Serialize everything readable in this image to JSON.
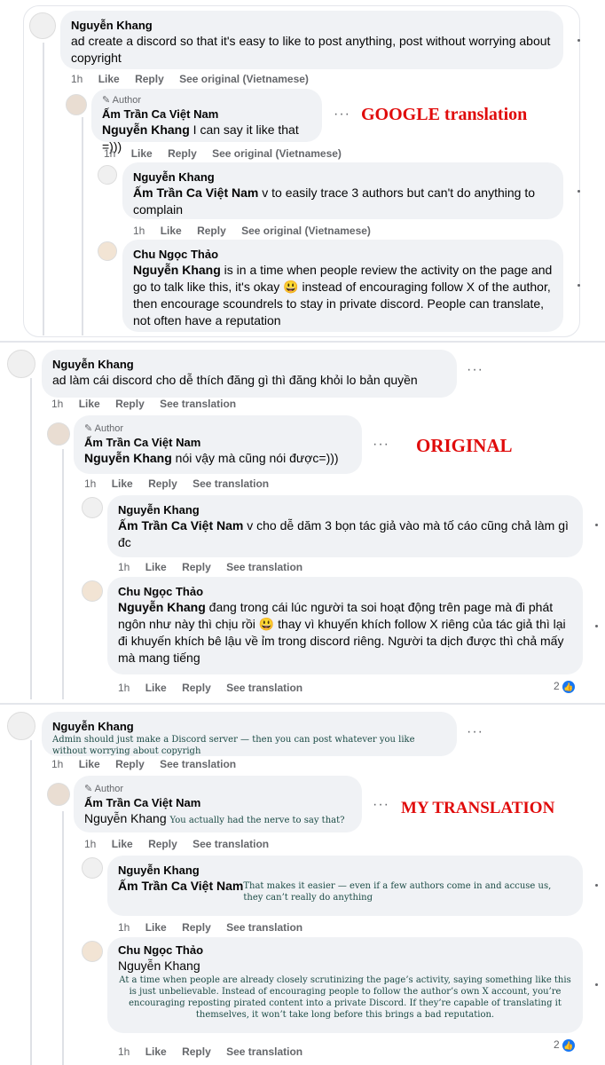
{
  "labels": {
    "google": "GOOGLE translation",
    "original": "ORIGINAL",
    "mine": "MY TRANSLATION"
  },
  "common": {
    "age": "1h",
    "like": "Like",
    "reply": "Reply",
    "see_original": "See original (Vietnamese)",
    "see_translation": "See translation",
    "author": "Author",
    "more": "···",
    "reactions": "2"
  },
  "google": {
    "c1": {
      "name": "Nguyễn Khang",
      "text": "ad create a discord so that it's easy to like to post anything, post without worrying about copyright"
    },
    "c2": {
      "name": "Ấm Trần Ca Việt Nam",
      "mention": "Nguyễn Khang",
      "text": " I can say it like that =)))"
    },
    "c3": {
      "name": "Nguyễn Khang",
      "mention": "Ấm Trần Ca Việt Nam",
      "text": " v to easily trace 3 authors but can't do anything to complain"
    },
    "c4": {
      "name": "Chu Ngọc Thảo",
      "mention": "Nguyễn Khang",
      "text1": " is in a time when people review the activity on the page and go to talk like this, it's okay ",
      "emoji": "😃",
      "text2": " instead of encouraging follow X of the author, then encourage scoundrels to stay in private discord. People can translate, not often have a reputation"
    }
  },
  "original": {
    "c1": {
      "name": "Nguyễn Khang",
      "text": "ad làm cái discord cho dễ thích đăng gì thì đăng khỏi lo bản quyền"
    },
    "c2": {
      "name": "Ấm Trần Ca Việt Nam",
      "mention": "Nguyễn Khang",
      "text": " nói vậy mà cũng nói được=)))"
    },
    "c3": {
      "name": "Nguyễn Khang",
      "mention": "Ấm Trần Ca Việt Nam",
      "text": " v cho dễ dăm 3 bọn tác giả vào mà tố cáo cũng chả làm gì đc"
    },
    "c4": {
      "name": "Chu Ngọc Thảo",
      "mention": "Nguyễn Khang",
      "text1": " đang trong cái lúc người ta soi hoạt động trên page mà đi phát ngôn như này thì chịu rồi ",
      "emoji": "😃",
      "text2": " thay vì khuyến khích follow X riêng của tác giả thì lại đi khuyến khích bê lậu về ỉm trong discord riêng. Người ta dịch được thì chả mấy mà mang tiếng"
    }
  },
  "mine": {
    "c1": {
      "name": "Nguyễn Khang",
      "text": "Admin should just make a Discord server — then you can post whatever you like without worrying about copyrigh"
    },
    "c2": {
      "name": "Ấm Trần Ca Việt Nam",
      "mention": "Nguyễn Khang",
      "text": "You actually had the nerve to say that?"
    },
    "c3": {
      "name": "Nguyễn Khang",
      "mention": "Ấm Trần Ca Việt Nam",
      "text": "That makes it easier — even if a few authors come in and accuse us, they can’t really do anything"
    },
    "c4": {
      "name": "Chu Ngọc Thảo",
      "mention": "Nguyễn Khang",
      "text": "At a time when people are already closely scrutinizing the page’s activity, saying something like this is just unbelievable. Instead of encouraging people to follow the author’s own X account, you’re encouraging reposting pirated content into a private Discord. If they’re capable of translating it themselves, it won’t take long before this brings a bad reputation."
    }
  },
  "icons": {
    "like": "like-icon",
    "pencil": "pencil-icon",
    "avatar": "user-avatar"
  },
  "colors": {
    "label": "#e00b0b",
    "bubble": "#f0f2f5",
    "like_badge": "#1877f2",
    "meta": "#65676b"
  }
}
